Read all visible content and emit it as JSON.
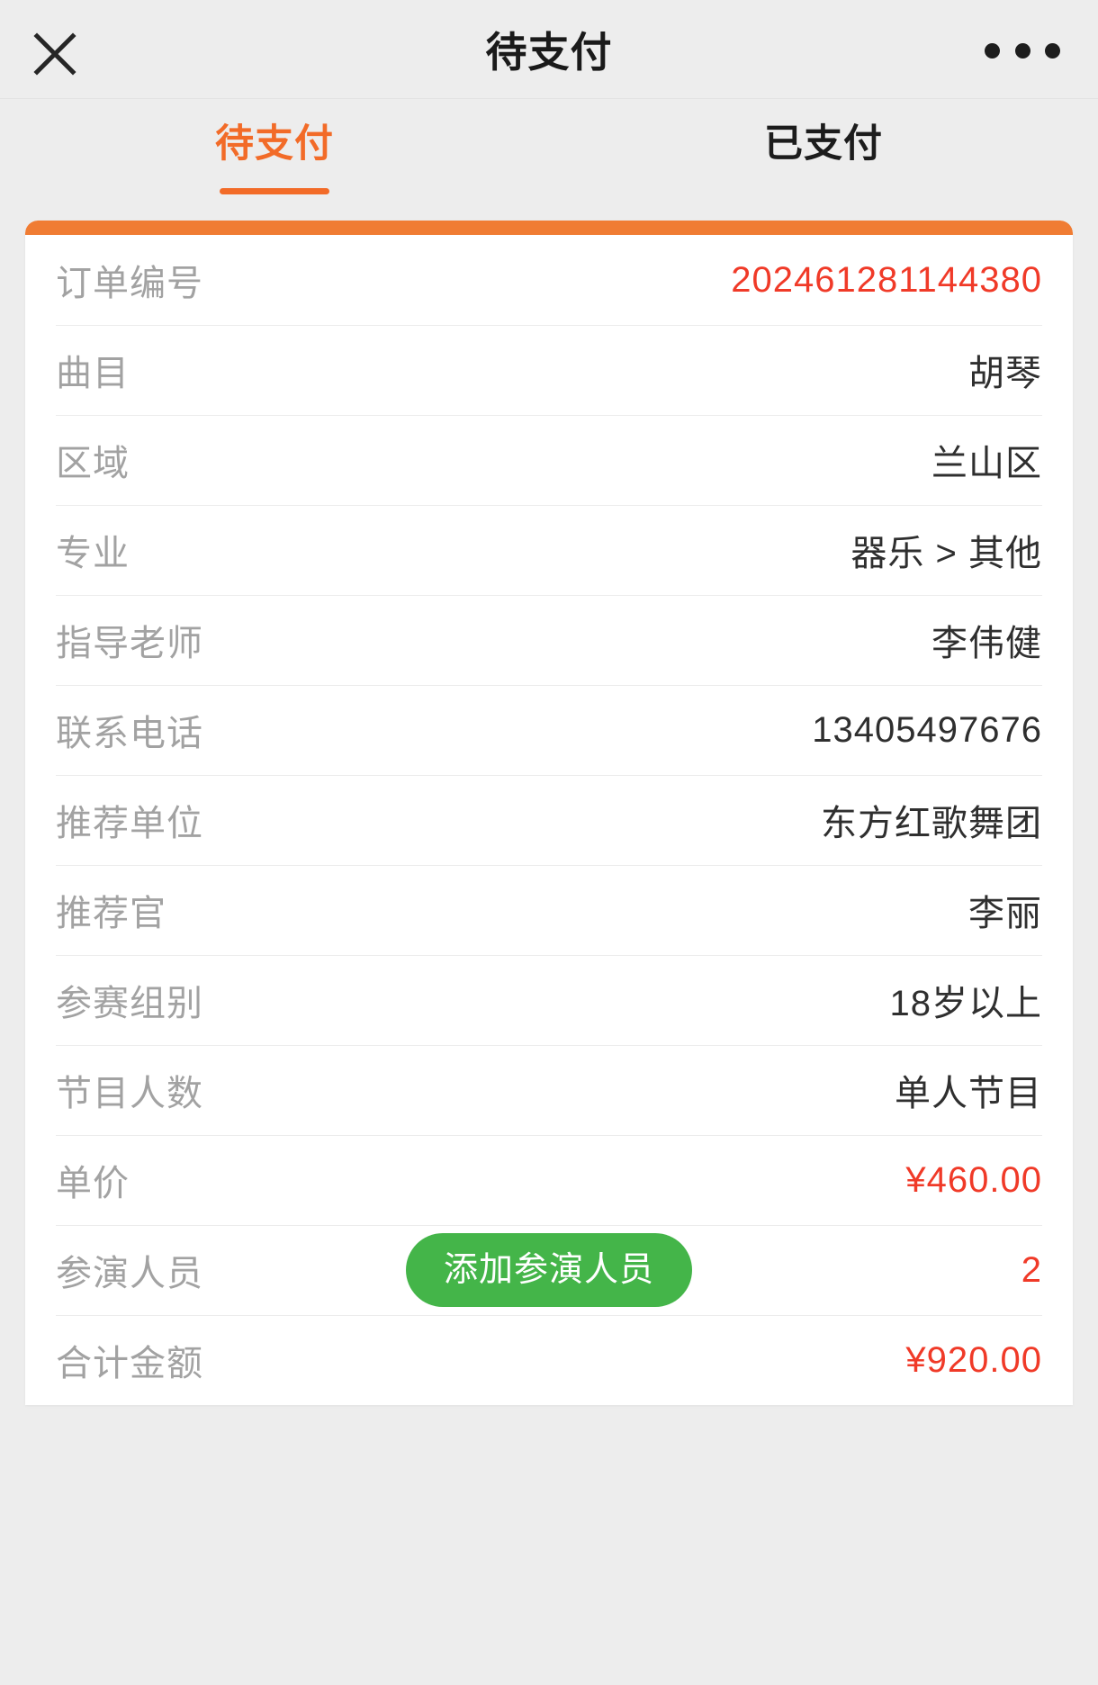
{
  "header": {
    "title": "待支付",
    "close_icon": "close-icon",
    "more_icon": "more-options-icon"
  },
  "tabs": [
    {
      "label": "待支付",
      "active": true
    },
    {
      "label": "已支付",
      "active": false
    }
  ],
  "colors": {
    "accent_orange": "#f26b28",
    "card_topbar_orange": "#f07c33",
    "value_red": "#f03a28",
    "button_green": "#44b549",
    "label_gray": "#a2a2a2",
    "value_dark": "#2f2f2f",
    "page_background": "#ededed"
  },
  "order_card": {
    "rows": [
      {
        "label": "订单编号",
        "value": "202461281144380",
        "style": "red"
      },
      {
        "label": "曲目",
        "value": "胡琴",
        "style": "normal"
      },
      {
        "label": "区域",
        "value": "兰山区",
        "style": "normal"
      },
      {
        "label": "专业",
        "value": "器乐 > 其他",
        "style": "normal"
      },
      {
        "label": "指导老师",
        "value": "李伟健",
        "style": "normal"
      },
      {
        "label": "联系电话",
        "value": "13405497676",
        "style": "normal"
      },
      {
        "label": "推荐单位",
        "value": "东方红歌舞团",
        "style": "normal"
      },
      {
        "label": "推荐官",
        "value": "李丽",
        "style": "normal"
      },
      {
        "label": "参赛组别",
        "value": "18岁以上",
        "style": "normal"
      },
      {
        "label": "节目人数",
        "value": "单人节目",
        "style": "normal"
      },
      {
        "label": "单价",
        "value": "¥460.00",
        "style": "money"
      },
      {
        "label": "参演人员",
        "value": "2",
        "style": "red",
        "action_label": "添加参演人员"
      },
      {
        "label": "合计金额",
        "value": "¥920.00",
        "style": "money"
      }
    ]
  }
}
